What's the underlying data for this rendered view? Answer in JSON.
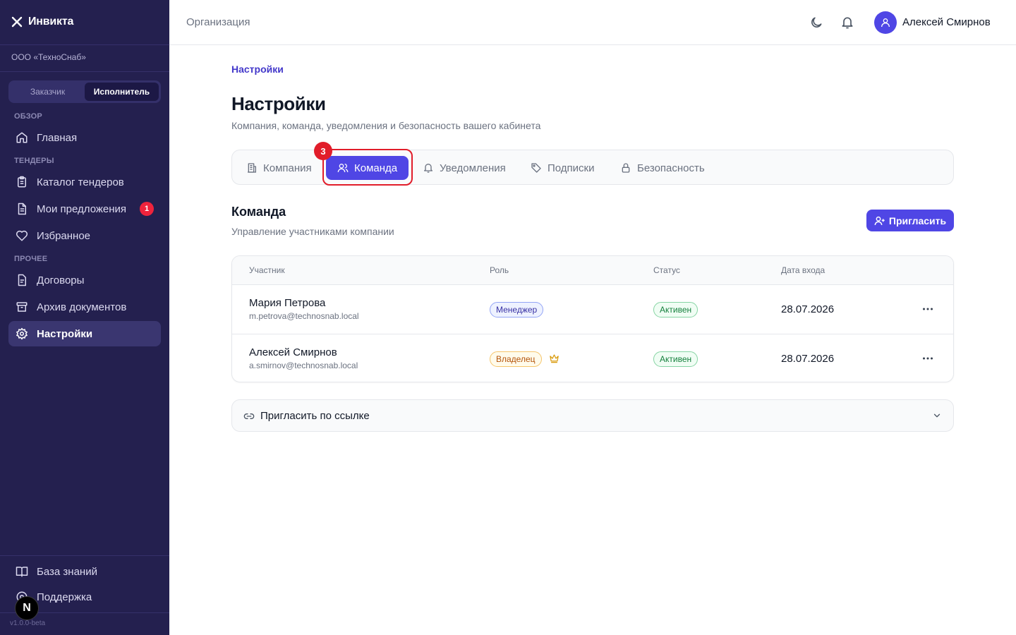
{
  "app": {
    "brand": "Инвикта",
    "org": "ООО «ТехноСнаб»",
    "version": "v1.0.0-beta"
  },
  "role_switch": {
    "options": [
      "Заказчик",
      "Исполнитель"
    ],
    "active": "Исполнитель"
  },
  "sidebar": {
    "sections": {
      "overview": "ОБЗОР",
      "tenders": "ТЕНДЕРЫ",
      "other": "ПРОЧЕЕ"
    },
    "items": [
      {
        "label": "Главная",
        "icon": "home-icon"
      },
      {
        "label": "Каталог тендеров",
        "icon": "clipboard-icon"
      },
      {
        "label": "Мои предложения",
        "icon": "document-icon",
        "badge": "1"
      },
      {
        "label": "Избранное",
        "icon": "heart-icon"
      },
      {
        "label": "Договоры",
        "icon": "contract-icon"
      },
      {
        "label": "Архив документов",
        "icon": "archive-icon"
      },
      {
        "label": "Настройки",
        "icon": "gear-icon",
        "active": true
      }
    ],
    "footer": [
      {
        "label": "База знаний",
        "icon": "book-icon"
      },
      {
        "label": "Поддержка",
        "icon": "support-icon"
      }
    ],
    "n_badge": "N"
  },
  "topbar": {
    "title": "Организация",
    "user_name": "Алексей Смирнов"
  },
  "breadcrumb": "Настройки",
  "page": {
    "title": "Настройки",
    "subtitle": "Компания, команда, уведомления и безопасность вашего кабинета"
  },
  "tabs": [
    {
      "label": "Компания",
      "icon": "building-icon"
    },
    {
      "label": "Команда",
      "icon": "users-icon",
      "active": true
    },
    {
      "label": "Уведомления",
      "icon": "bell-icon"
    },
    {
      "label": "Подписки",
      "icon": "tag-icon"
    },
    {
      "label": "Безопасность",
      "icon": "lock-icon"
    }
  ],
  "step_badge": "3",
  "team": {
    "title": "Команда",
    "subtitle": "Управление участниками компании",
    "invite_label": "Пригласить",
    "columns": [
      "Участник",
      "Роль",
      "Статус",
      "Дата входа"
    ],
    "members": [
      {
        "name": "Мария Петрова",
        "email": "m.petrova@technosnab.local",
        "role": "Менеджер",
        "status": "Активен",
        "date": "28.07.2026"
      },
      {
        "name": "Алексей Смирнов",
        "email": "a.smirnov@technosnab.local",
        "role": "Владелец",
        "status": "Активен",
        "date": "28.07.2026"
      }
    ]
  },
  "invite_link": {
    "label": "Пригласить по ссылке"
  },
  "colors": {
    "sidebar_bg": "#24204f",
    "accent": "#4f46e5",
    "highlight": "#e11d2a",
    "active_status": "#15803d",
    "owner": "#b45309"
  }
}
